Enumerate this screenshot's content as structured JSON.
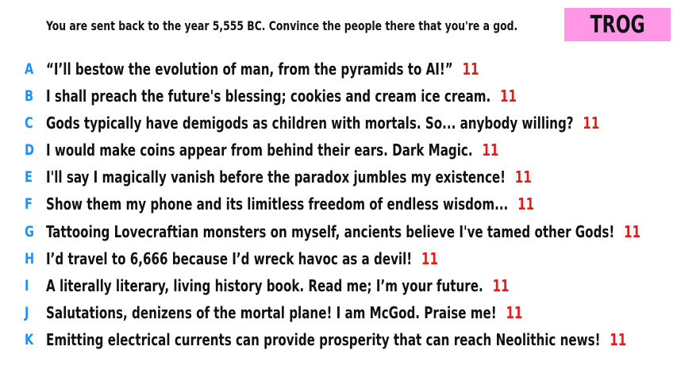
{
  "prompt": "You are sent back to the year 5,555 BC. Convince the people there that you're a god.",
  "logo": "TROG",
  "colors": {
    "letter": "#1e90ff",
    "score": "#e51a1a",
    "logo_bg": "#ff96e6"
  },
  "answers": [
    {
      "letter": "A",
      "text": "“I’ll bestow the evolution of man, from the pyramids to AI!”",
      "score": "11"
    },
    {
      "letter": "B",
      "text": "I shall preach the future's blessing; cookies and cream ice cream.",
      "score": "11"
    },
    {
      "letter": "C",
      "text": "Gods typically have demigods as children with mortals. So... anybody willing?",
      "score": "11"
    },
    {
      "letter": "D",
      "text": "I would make coins appear from behind their ears. Dark Magic.",
      "score": "11"
    },
    {
      "letter": "E",
      "text": "I'll say I magically vanish before the paradox jumbles my existence!",
      "score": "11"
    },
    {
      "letter": "F",
      "text": "Show them my phone and its limitless freedom of endless wisdom...",
      "score": "11"
    },
    {
      "letter": "G",
      "text": "Tattooing Lovecraftian monsters on myself, ancients believe I've tamed other Gods!",
      "score": "11"
    },
    {
      "letter": "H",
      "text": "I’d travel to 6,666 because I’d wreck havoc as a devil!",
      "score": "11"
    },
    {
      "letter": "I",
      "text": "A literally literary, living history book. Read me; I’m your future.",
      "score": "11"
    },
    {
      "letter": "J",
      "text": "Salutations, denizens of the mortal plane! I am McGod. Praise me!",
      "score": "11"
    },
    {
      "letter": "K",
      "text": "Emitting electrical currents can provide prosperity that can reach Neolithic news!",
      "score": "11"
    }
  ]
}
